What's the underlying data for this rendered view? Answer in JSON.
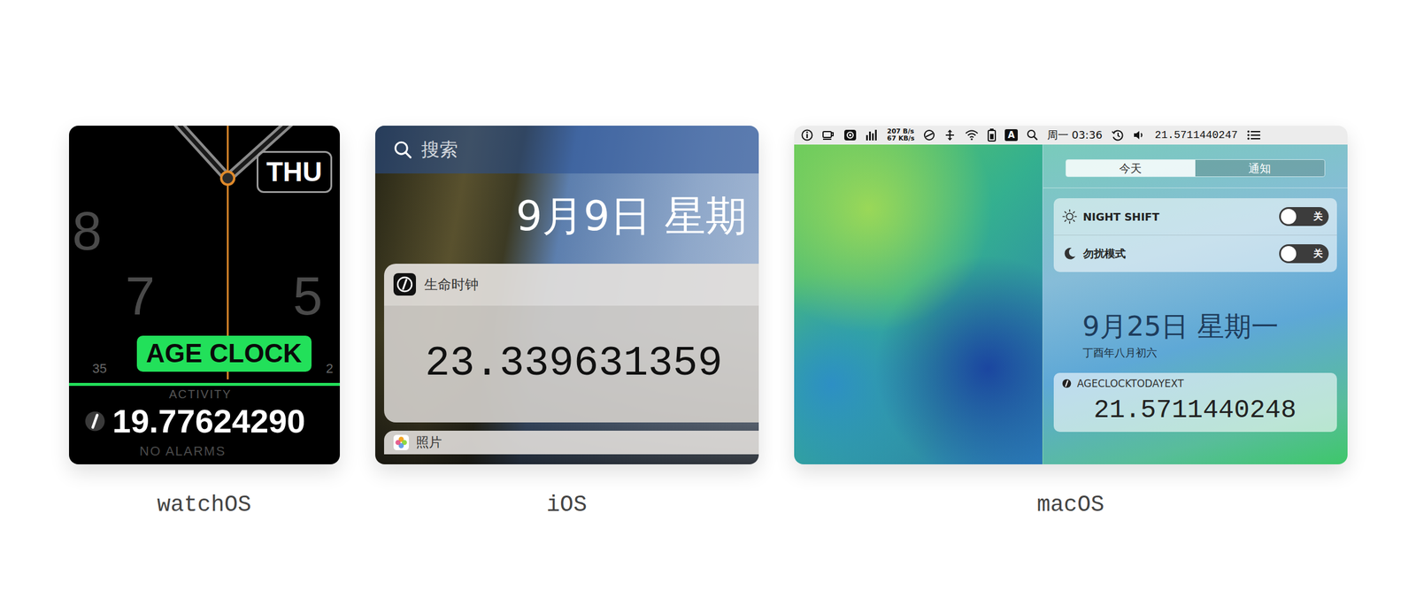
{
  "watch": {
    "caption": "watchOS",
    "day": "THU",
    "numerals": [
      "8",
      "7",
      "5"
    ],
    "small_marks": [
      "35",
      "2"
    ],
    "complication": "ACTIVITY",
    "badge": "AGE CLOCK",
    "value": "19.77624290",
    "footer": "NO ALARMS"
  },
  "ios": {
    "caption": "iOS",
    "search_placeholder": "搜索",
    "date": "9月9日 星期",
    "widget": {
      "title": "生命时钟",
      "value": "23.339631359"
    },
    "next_widget": {
      "title": "照片"
    }
  },
  "mac": {
    "caption": "macOS",
    "menu_bar": {
      "network_up": "207 B/s",
      "network_down": "67 KB/s",
      "input_source": "A",
      "clock": "周一 03:36",
      "age": "21.5711440247"
    },
    "tabs": [
      {
        "label": "今天",
        "selected": true
      },
      {
        "label": "通知",
        "selected": false
      }
    ],
    "toggles": [
      {
        "label": "NIGHT SHIFT",
        "state": "关",
        "on": false
      },
      {
        "label": "勿扰模式",
        "state": "关",
        "on": false
      }
    ],
    "date": "9月25日 星期一",
    "lunar": "丁酉年八月初六",
    "widget": {
      "title": "AGECLOCKTODAYEXT",
      "value": "21.5711440248"
    }
  }
}
